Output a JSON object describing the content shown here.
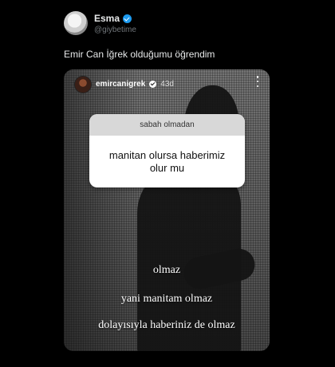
{
  "tweet": {
    "author_name": "Esma",
    "author_handle": "@giybetime",
    "text": "Emir Can İğrek olduğumu öğrendim"
  },
  "story": {
    "username": "emircanigrek",
    "time": "43d",
    "question_header": "sabah olmadan",
    "question_answer": "manitan olursa haberimiz olur mu",
    "captions": [
      "olmaz",
      "yani manitam olmaz",
      "dolayısıyla haberiniz de olmaz"
    ]
  },
  "icons": {
    "verified": "verified-badge-icon",
    "more": "more-vertical-icon"
  },
  "colors": {
    "background": "#000000",
    "verified_blue": "#1d9bf0",
    "handle_gray": "#71767b"
  }
}
